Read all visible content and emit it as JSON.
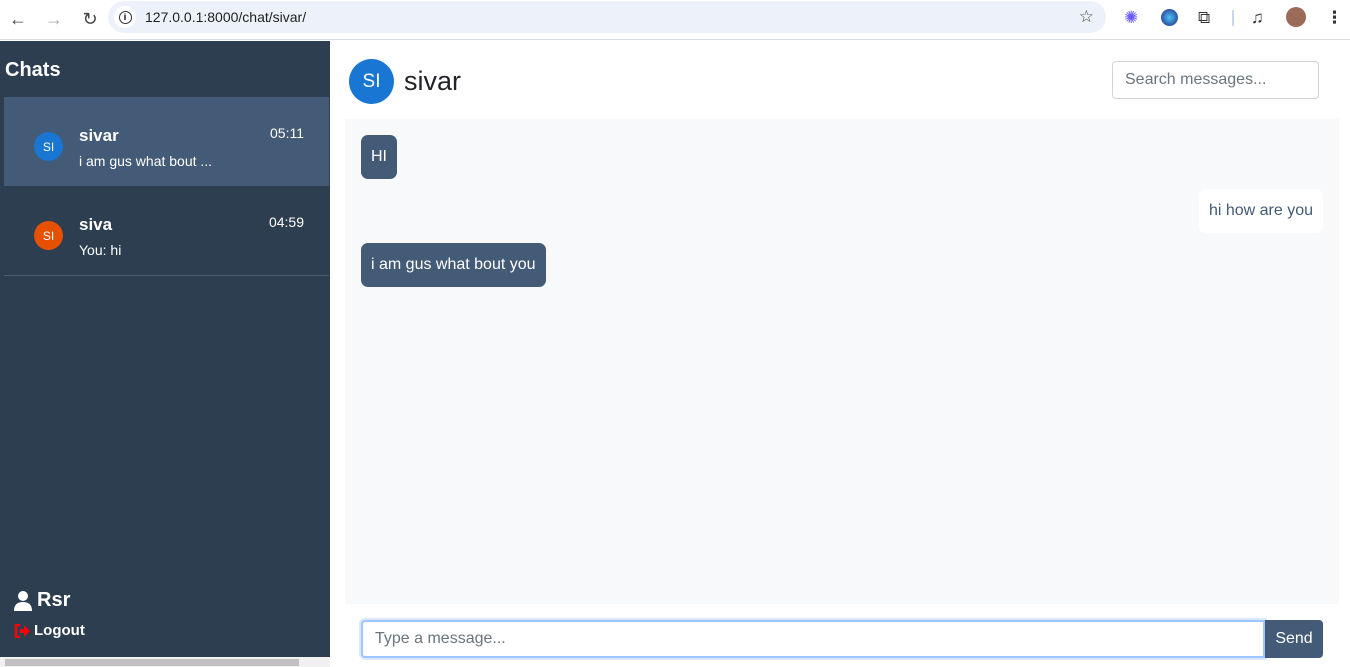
{
  "browser": {
    "url": "127.0.0.1:8000/chat/sivar/",
    "icons": [
      "back-icon",
      "forward-icon",
      "reload-icon",
      "info-icon",
      "star-icon",
      "extension-icon",
      "puzzle-icon",
      "media-icon",
      "profile-avatar",
      "menu-icon"
    ]
  },
  "sidebar": {
    "title": "Chats",
    "items": [
      {
        "initials": "SI",
        "name": "sivar",
        "time": "05:11",
        "preview": "i am gus what bout ...",
        "color": "#1976d2",
        "active": true
      },
      {
        "initials": "SI",
        "name": "siva",
        "time": "04:59",
        "preview": "You: hi",
        "color": "#e65100",
        "active": false
      }
    ],
    "user": "Rsr",
    "logout": "Logout"
  },
  "chat": {
    "initials": "SI",
    "name": "sivar",
    "search_placeholder": "Search messages...",
    "messages": [
      {
        "text": "HI",
        "dir": "received"
      },
      {
        "text": "hi how are you",
        "dir": "sent"
      },
      {
        "text": "i am gus what bout you",
        "dir": "received"
      }
    ],
    "input_placeholder": "Type a message...",
    "send": "Send"
  },
  "colors": {
    "sidebar": "#2c3e50",
    "accent": "#435b76",
    "logout": "#ff0000"
  }
}
